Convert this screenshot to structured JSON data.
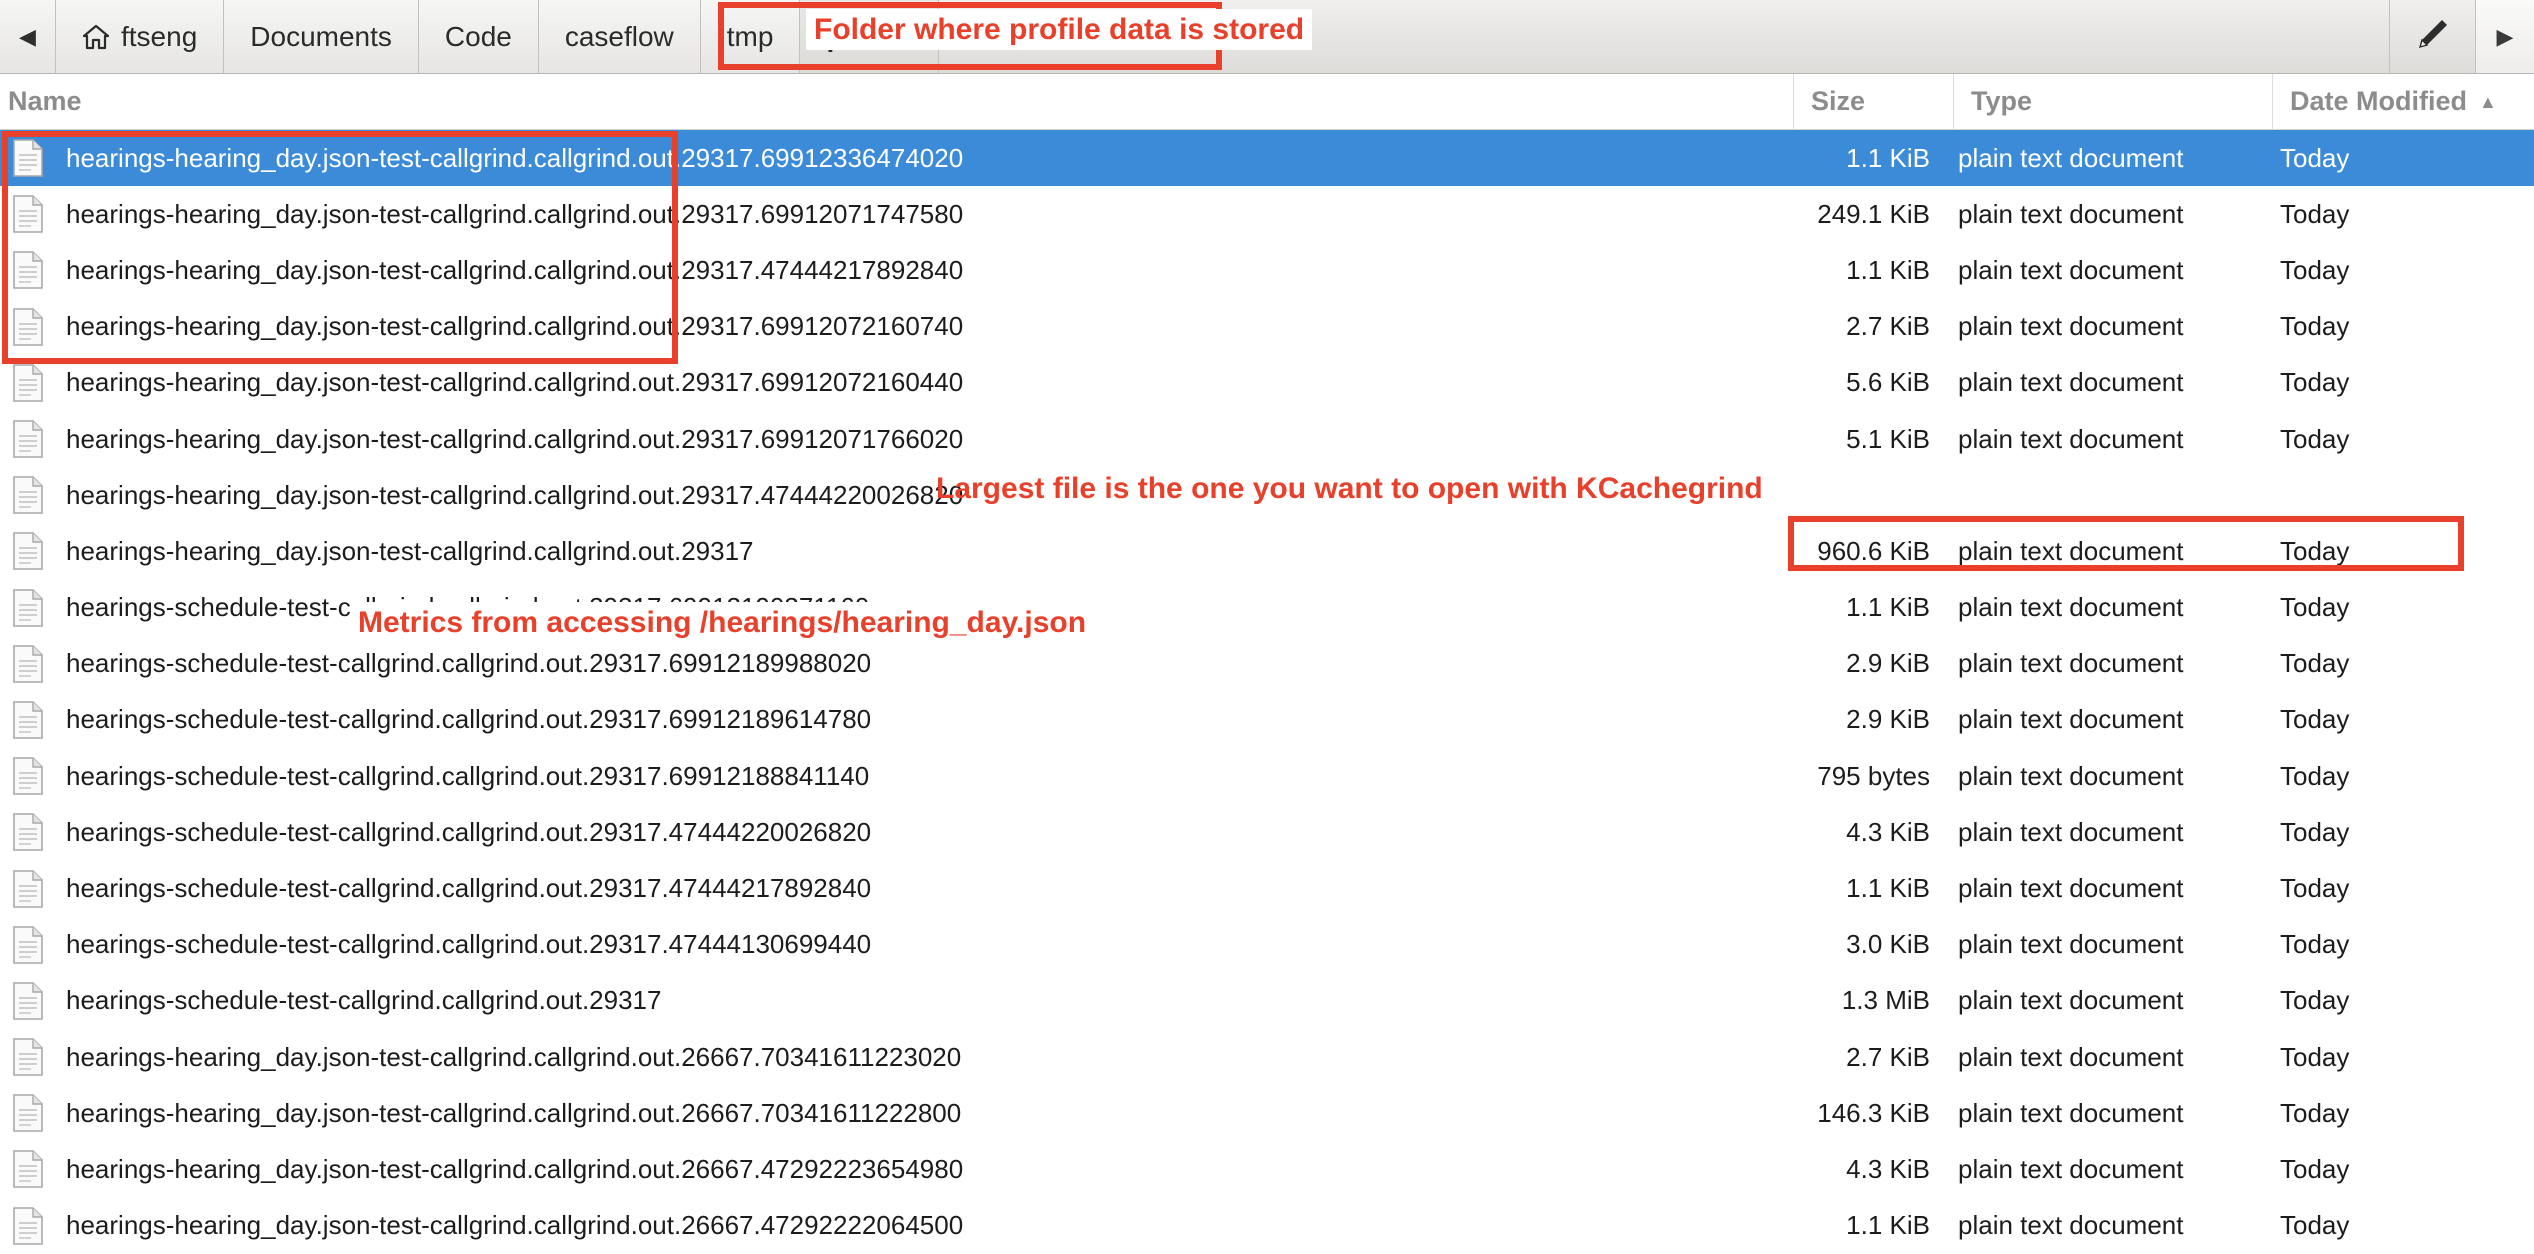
{
  "window": {
    "app": "file-manager",
    "accent_selected": "#3c8bd9",
    "annotation_color": "#e8402a"
  },
  "toolbar": {
    "back_icon": "chevron-left-icon",
    "back_label": "◀",
    "home_icon": "home-icon",
    "forward_icon": "chevron-right-icon",
    "forward_label": "▶",
    "edit_icon": "pencil-icon",
    "breadcrumbs": [
      {
        "label": "ftseng",
        "active": false,
        "has_home_icon": true
      },
      {
        "label": "Documents",
        "active": false,
        "has_home_icon": false
      },
      {
        "label": "Code",
        "active": false,
        "has_home_icon": false
      },
      {
        "label": "caseflow",
        "active": false,
        "has_home_icon": false
      },
      {
        "label": "tmp",
        "active": false,
        "has_home_icon": false
      },
      {
        "label": "profile",
        "active": true,
        "has_home_icon": false
      }
    ]
  },
  "columns": {
    "name": "Name",
    "size": "Size",
    "type": "Type",
    "date": "Date Modified",
    "sort_arrow": "▲"
  },
  "files": [
    {
      "name": "hearings-hearing_day.json-test-callgrind.callgrind.out.29317.69912336474020",
      "size": "1.1 KiB",
      "type": "plain text document",
      "date": "Today",
      "selected": true
    },
    {
      "name": "hearings-hearing_day.json-test-callgrind.callgrind.out.29317.69912071747580",
      "size": "249.1 KiB",
      "type": "plain text document",
      "date": "Today",
      "selected": false
    },
    {
      "name": "hearings-hearing_day.json-test-callgrind.callgrind.out.29317.47444217892840",
      "size": "1.1 KiB",
      "type": "plain text document",
      "date": "Today",
      "selected": false
    },
    {
      "name": "hearings-hearing_day.json-test-callgrind.callgrind.out.29317.69912072160740",
      "size": "2.7 KiB",
      "type": "plain text document",
      "date": "Today",
      "selected": false
    },
    {
      "name": "hearings-hearing_day.json-test-callgrind.callgrind.out.29317.69912072160440",
      "size": "5.6 KiB",
      "type": "plain text document",
      "date": "Today",
      "selected": false
    },
    {
      "name": "hearings-hearing_day.json-test-callgrind.callgrind.out.29317.69912071766020",
      "size": "5.1 KiB",
      "type": "plain text document",
      "date": "Today",
      "selected": false
    },
    {
      "name": "hearings-hearing_day.json-test-callgrind.callgrind.out.29317.47444220026820",
      "size": "",
      "type": "",
      "date": "",
      "selected": false
    },
    {
      "name": "hearings-hearing_day.json-test-callgrind.callgrind.out.29317",
      "size": "960.6 KiB",
      "type": "plain text document",
      "date": "Today",
      "selected": false
    },
    {
      "name": "hearings-schedule-test-callgrind.callgrind.out.29317.69912190371160",
      "size": "1.1 KiB",
      "type": "plain text document",
      "date": "Today",
      "selected": false
    },
    {
      "name": "hearings-schedule-test-callgrind.callgrind.out.29317.69912189988020",
      "size": "2.9 KiB",
      "type": "plain text document",
      "date": "Today",
      "selected": false
    },
    {
      "name": "hearings-schedule-test-callgrind.callgrind.out.29317.69912189614780",
      "size": "2.9 KiB",
      "type": "plain text document",
      "date": "Today",
      "selected": false
    },
    {
      "name": "hearings-schedule-test-callgrind.callgrind.out.29317.69912188841140",
      "size": "795 bytes",
      "type": "plain text document",
      "date": "Today",
      "selected": false
    },
    {
      "name": "hearings-schedule-test-callgrind.callgrind.out.29317.47444220026820",
      "size": "4.3 KiB",
      "type": "plain text document",
      "date": "Today",
      "selected": false
    },
    {
      "name": "hearings-schedule-test-callgrind.callgrind.out.29317.47444217892840",
      "size": "1.1 KiB",
      "type": "plain text document",
      "date": "Today",
      "selected": false
    },
    {
      "name": "hearings-schedule-test-callgrind.callgrind.out.29317.47444130699440",
      "size": "3.0 KiB",
      "type": "plain text document",
      "date": "Today",
      "selected": false
    },
    {
      "name": "hearings-schedule-test-callgrind.callgrind.out.29317",
      "size": "1.3 MiB",
      "type": "plain text document",
      "date": "Today",
      "selected": false
    },
    {
      "name": "hearings-hearing_day.json-test-callgrind.callgrind.out.26667.70341611223020",
      "size": "2.7 KiB",
      "type": "plain text document",
      "date": "Today",
      "selected": false
    },
    {
      "name": "hearings-hearing_day.json-test-callgrind.callgrind.out.26667.70341611222800",
      "size": "146.3 KiB",
      "type": "plain text document",
      "date": "Today",
      "selected": false
    },
    {
      "name": "hearings-hearing_day.json-test-callgrind.callgrind.out.26667.47292223654980",
      "size": "4.3 KiB",
      "type": "plain text document",
      "date": "Today",
      "selected": false
    },
    {
      "name": "hearings-hearing_day.json-test-callgrind.callgrind.out.26667.47292222064500",
      "size": "1.1 KiB",
      "type": "plain text document",
      "date": "Today",
      "selected": false
    }
  ],
  "annotations": {
    "path_note": "Folder where profile data is stored",
    "metrics_note": "Metrics from accessing /hearings/hearing_day.json",
    "largest_note": "Largest file is the one you want to open with KCachegrind"
  }
}
